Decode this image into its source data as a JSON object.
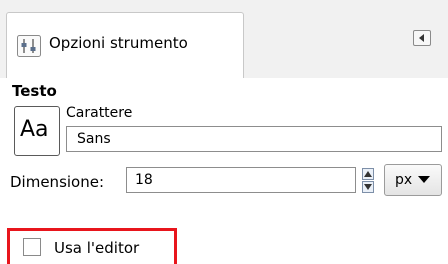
{
  "tab": {
    "label": "Opzioni strumento",
    "icon": "tool-options-icon",
    "menu_icon": "tab-menu-icon"
  },
  "section": {
    "title": "Testo"
  },
  "font": {
    "preview_text": "Aa",
    "label": "Carattere",
    "value": "Sans"
  },
  "size": {
    "label": "Dimensione:",
    "value": "18",
    "unit": "px"
  },
  "editor_option": {
    "label": "Usa l'editor",
    "checked": false
  },
  "colors": {
    "highlight": "#e8151c",
    "tabbar_bg": "#f1f1f1"
  }
}
